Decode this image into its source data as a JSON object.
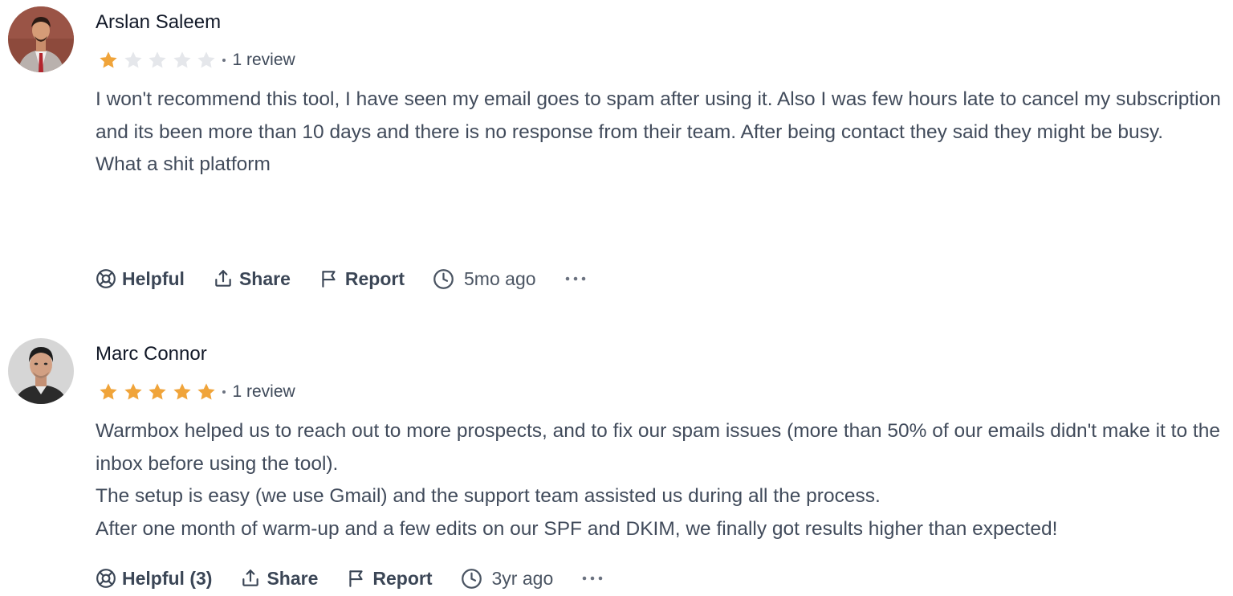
{
  "reviews": [
    {
      "author": "Arslan Saleem",
      "rating": 1,
      "max_rating": 5,
      "review_count": "1 review",
      "paragraphs": [
        "I won't recommend this tool, I have seen my email goes to spam after using it. Also I was few hours late to cancel my subscription and its been more than 10 days and there is no response from their team. After being contact they said they might be busy.",
        "",
        "What a shit platform"
      ],
      "actions": {
        "helpful": "Helpful",
        "share": "Share",
        "report": "Report",
        "time": "5mo ago"
      }
    },
    {
      "author": "Marc Connor",
      "rating": 5,
      "max_rating": 5,
      "review_count": "1 review",
      "paragraphs": [
        "Warmbox helped us to reach out to more prospects, and to fix our spam issues (more than 50% of our emails didn't make it to the inbox before using the tool).",
        "The setup is easy (we use Gmail) and the support team assisted us during all the process.",
        "After one month of warm-up and a few edits on our SPF and DKIM, we finally got results higher than expected!"
      ],
      "actions": {
        "helpful": "Helpful (3)",
        "share": "Share",
        "report": "Report",
        "time": "3yr ago"
      }
    }
  ],
  "colors": {
    "star_filled": "#f0a43a",
    "star_empty": "#e5e7eb",
    "text": "#414b5b",
    "author": "#111827"
  },
  "icons": {
    "helpful": "lifebuoy-icon",
    "share": "share-upload-icon",
    "report": "flag-icon",
    "time": "clock-icon",
    "more": "more-horizontal-icon"
  }
}
